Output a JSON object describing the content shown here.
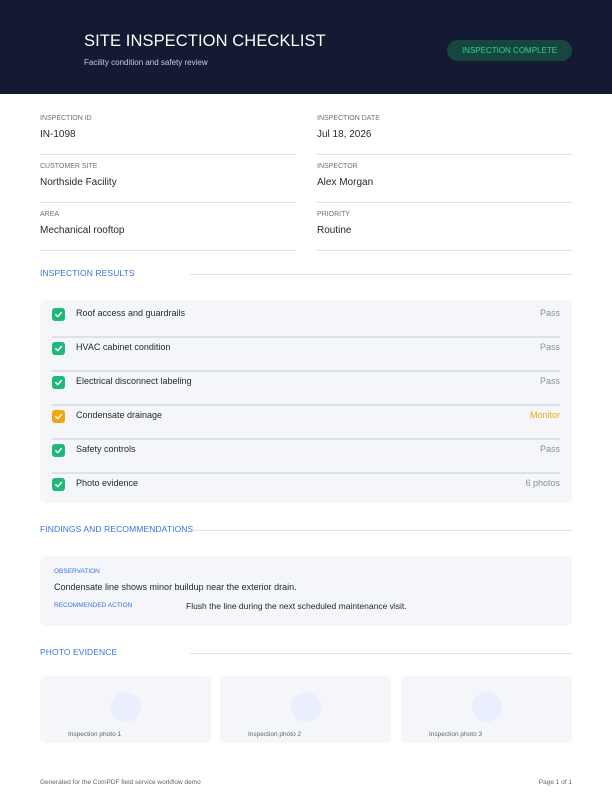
{
  "header": {
    "title": "SITE INSPECTION CHECKLIST",
    "subtitle": "Facility condition and safety review",
    "status_badge": "INSPECTION COMPLETE",
    "status_color": "#2fd390"
  },
  "fields": [
    {
      "label": "INSPECTION ID",
      "value": "IN-1098"
    },
    {
      "label": "INSPECTION DATE",
      "value": "Jul 18, 2026"
    },
    {
      "label": "CUSTOMER SITE",
      "value": "Northside Facility"
    },
    {
      "label": "INSPECTOR",
      "value": "Alex Morgan"
    },
    {
      "label": "AREA",
      "value": "Mechanical rooftop"
    },
    {
      "label": "PRIORITY",
      "value": "Routine"
    }
  ],
  "results": {
    "title": "INSPECTION RESULTS",
    "items": [
      {
        "name": "Roof access and guardrails",
        "status": "Pass",
        "check_color": "#1fb87a"
      },
      {
        "name": "HVAC cabinet condition",
        "status": "Pass",
        "check_color": "#1fb87a"
      },
      {
        "name": "Electrical disconnect labeling",
        "status": "Pass",
        "check_color": "#1fb87a"
      },
      {
        "name": "Condensate drainage",
        "status": "Monitor",
        "check_color": "#f2a50f",
        "status_color": "#f2a50f"
      },
      {
        "name": "Safety controls",
        "status": "Pass",
        "check_color": "#1fb87a"
      },
      {
        "name": "Photo evidence",
        "status": "6 photos",
        "check_color": "#1fb87a"
      }
    ]
  },
  "findings": {
    "title": "FINDINGS AND RECOMMENDATIONS",
    "observation_label": "OBSERVATION",
    "observation_text": "Condensate line shows minor buildup near the exterior drain.",
    "recommended_label": "RECOMMENDED ACTION",
    "recommended_text": "Flush the line during the next scheduled maintenance visit."
  },
  "photos": {
    "title": "PHOTO EVIDENCE",
    "captions": [
      "Inspection photo 1",
      "Inspection photo 2",
      "Inspection photo 3"
    ]
  },
  "footer": {
    "left": "Generated for the ComPDF field service workflow demo",
    "right": "Page 1 of 1"
  }
}
